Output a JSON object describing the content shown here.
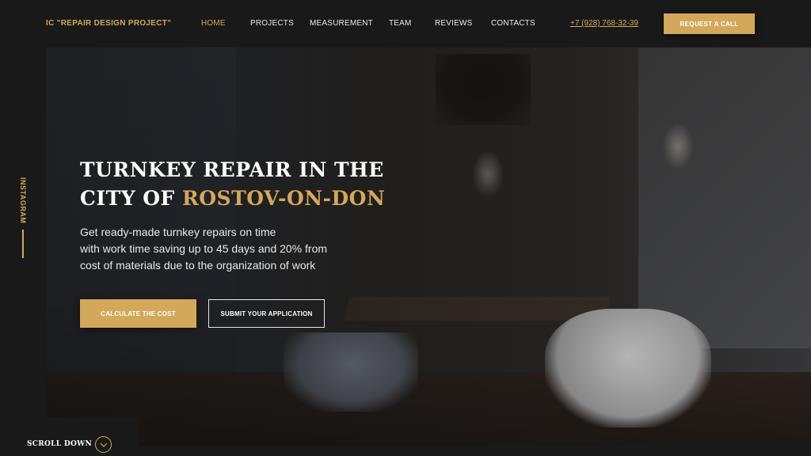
{
  "header": {
    "logo": "IC \"REPAIR DESIGN PROJECT\"",
    "nav": [
      {
        "label": "HOME",
        "active": true
      },
      {
        "label": "PROJECTS",
        "active": false
      },
      {
        "label": "MEASUREMENT",
        "active": false
      },
      {
        "label": "TEAM",
        "active": false
      },
      {
        "label": "REVIEWS",
        "active": false
      },
      {
        "label": "CONTACTS",
        "active": false
      }
    ],
    "phone": "+7 (928) 768-32-39",
    "request_button": "REQUEST A CALL"
  },
  "sidebar": {
    "social_link": "INSTAGRAM"
  },
  "hero": {
    "title_line1": "TURNKEY REPAIR IN THE",
    "title_line2_prefix": "CITY OF ",
    "title_accent": "ROSTOV-ON-DON",
    "subtitle_line1": "Get ready-made turnkey repairs on time",
    "subtitle_line2": "with work time saving up to 45 days and 20% from",
    "subtitle_line3": "cost of materials due to the organization of work",
    "primary_button": "CALCULATE THE COST",
    "secondary_button": "SUBMIT YOUR APPLICATION"
  },
  "scroll": {
    "label": "SCROLL DOWN",
    "icon": "chevron-down-icon"
  },
  "colors": {
    "accent": "#d4a85a",
    "background": "#191919",
    "text": "#ffffff"
  }
}
